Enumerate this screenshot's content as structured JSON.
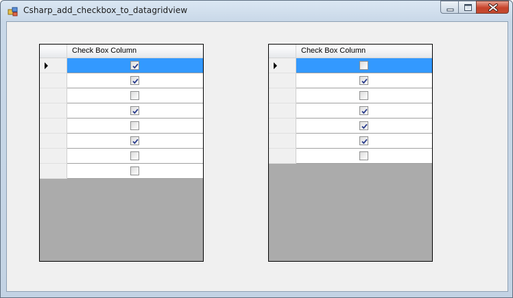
{
  "window": {
    "title": "Csharp_add_checkbox_to_datagridview",
    "icon": "winforms-app-icon",
    "controls": [
      "minimize-icon",
      "maximize-icon",
      "close-icon"
    ]
  },
  "grids": [
    {
      "column_header": "Check Box Column",
      "selected_row": 0,
      "rows": [
        true,
        true,
        false,
        true,
        false,
        true,
        false,
        false
      ]
    },
    {
      "column_header": "Check Box Column",
      "selected_row": 0,
      "rows": [
        false,
        true,
        false,
        true,
        true,
        true,
        false
      ]
    }
  ],
  "colors": {
    "selection": "#3399ff",
    "grid_background": "#ababab",
    "client_background": "#f0f0f0"
  }
}
